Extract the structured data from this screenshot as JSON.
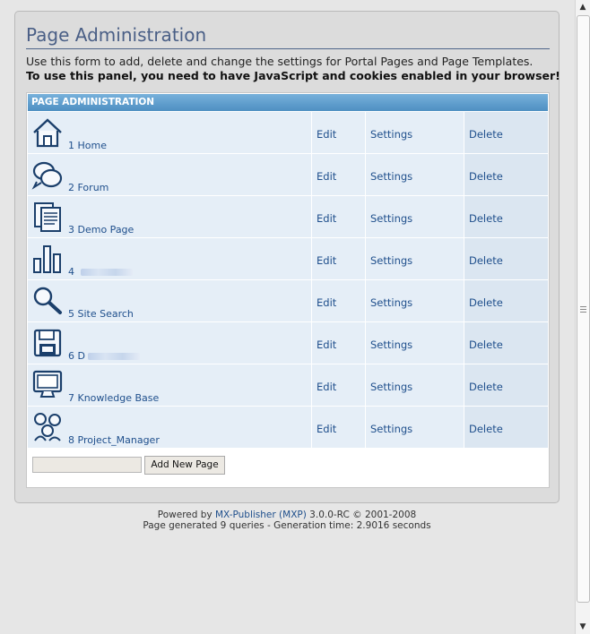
{
  "header": {
    "title": "Page Administration",
    "description": "Use this form to add, delete and change the settings for Portal Pages and Page Templates.",
    "warning": "To use this panel, you need to have JavaScript and cookies enabled in your browser!"
  },
  "table": {
    "header": "PAGE ADMINISTRATION",
    "actions": {
      "edit": "Edit",
      "settings": "Settings",
      "delete": "Delete"
    },
    "rows": [
      {
        "number": "1",
        "name": "Home",
        "icon": "home-icon"
      },
      {
        "number": "2",
        "name": "Forum",
        "icon": "forum-icon"
      },
      {
        "number": "3",
        "name": "Demo Page",
        "icon": "document-icon"
      },
      {
        "number": "4",
        "name": "",
        "icon": "statistics-icon",
        "redacted": true
      },
      {
        "number": "5",
        "name": "Site Search",
        "icon": "magnifier-icon"
      },
      {
        "number": "6",
        "name": "D",
        "icon": "floppy-disk-icon",
        "redacted": true
      },
      {
        "number": "7",
        "name": "Knowledge Base",
        "icon": "monitor-icon"
      },
      {
        "number": "8",
        "name": "Project_Manager",
        "icon": "people-icon"
      }
    ]
  },
  "add_page": {
    "input_value": "",
    "button_label": "Add New Page"
  },
  "footer": {
    "powered_prefix": "Powered by",
    "powered_link": "MX-Publisher (MXP)",
    "version": "3.0.0-RC © 2001-2008",
    "generated": "Page generated 9 queries - Generation time: 2.9016 seconds"
  },
  "colors": {
    "header_blue": "#5b9ccd",
    "link": "#1f4f8c",
    "title": "#4a5f86"
  }
}
